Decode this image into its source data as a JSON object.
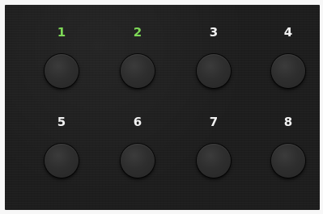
{
  "pads": [
    {
      "label": "1",
      "color": "#7ed957",
      "active": true
    },
    {
      "label": "2",
      "color": "#7ed957",
      "active": true
    },
    {
      "label": "3",
      "color": "#f2f2f2",
      "active": false
    },
    {
      "label": "4",
      "color": "#f2f2f2",
      "active": false
    },
    {
      "label": "5",
      "color": "#f2f2f2",
      "active": false
    },
    {
      "label": "6",
      "color": "#f2f2f2",
      "active": false
    },
    {
      "label": "7",
      "color": "#f2f2f2",
      "active": false
    },
    {
      "label": "8",
      "color": "#f2f2f2",
      "active": false
    }
  ],
  "colors": {
    "active_label": "#7ed957",
    "inactive_label": "#f2f2f2",
    "panel_background": "#1d1d1d",
    "page_background": "#f7f7f7"
  }
}
